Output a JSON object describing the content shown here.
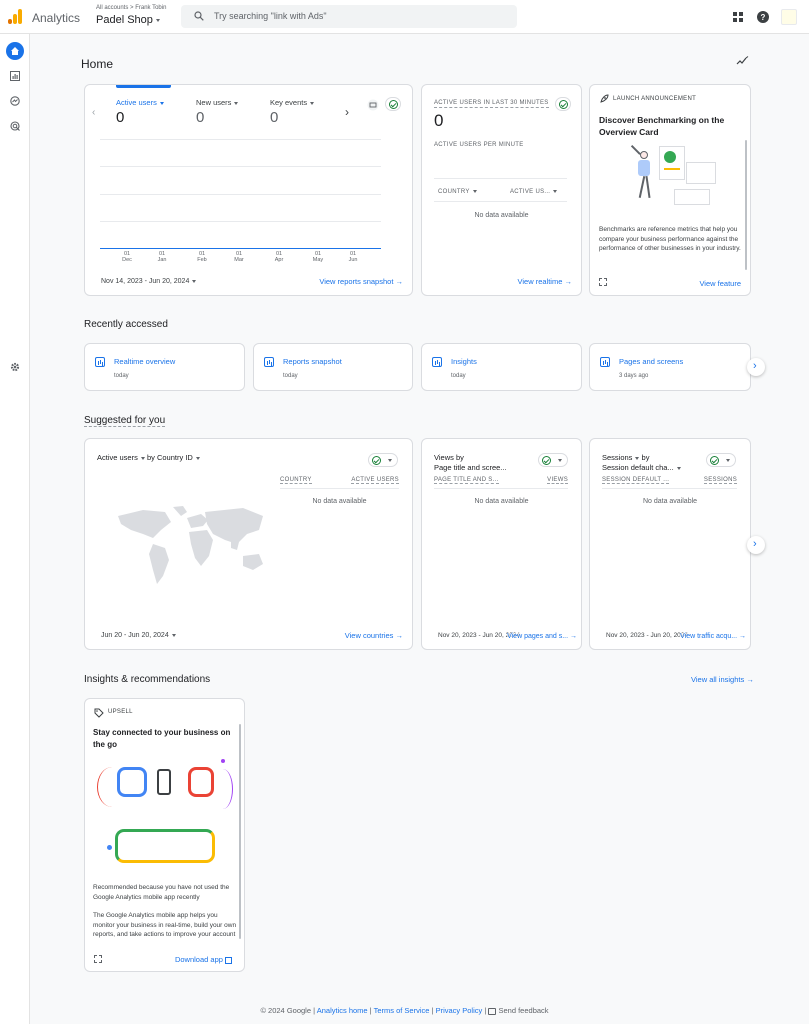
{
  "header": {
    "brand": "Analytics",
    "breadcrumb": "All accounts > Frank Tobin",
    "property": "Padel Shop",
    "search_placeholder": "Try searching \"link with Ads\""
  },
  "page": {
    "title": "Home"
  },
  "overview": {
    "metrics": [
      {
        "label": "Active users",
        "value": "0"
      },
      {
        "label": "New users",
        "value": "0"
      },
      {
        "label": "Key events",
        "value": "0"
      }
    ],
    "x_ticks": [
      {
        "day": "01",
        "month": "Dec"
      },
      {
        "day": "01",
        "month": "Jan"
      },
      {
        "day": "01",
        "month": "Feb"
      },
      {
        "day": "01",
        "month": "Mar"
      },
      {
        "day": "01",
        "month": "Apr"
      },
      {
        "day": "01",
        "month": "May"
      },
      {
        "day": "01",
        "month": "Jun"
      }
    ],
    "date_range": "Nov 14, 2023 - Jun 20, 2024",
    "link": "View reports snapshot"
  },
  "realtime": {
    "title": "ACTIVE USERS IN LAST 30 MINUTES",
    "value": "0",
    "per_minute": "ACTIVE USERS PER MINUTE",
    "col_country": "COUNTRY",
    "col_users": "ACTIVE US...",
    "empty": "No data available",
    "link": "View realtime"
  },
  "launch": {
    "tag": "LAUNCH ANNOUNCEMENT",
    "title": "Discover Benchmarking on the Overview Card",
    "body": "Benchmarks are reference metrics that help you compare your business performance against the performance of other businesses in your industry.",
    "link": "View feature"
  },
  "recent": {
    "title": "Recently accessed",
    "items": [
      {
        "label": "Realtime overview",
        "time": "today"
      },
      {
        "label": "Reports snapshot",
        "time": "today"
      },
      {
        "label": "Insights",
        "time": "today"
      },
      {
        "label": "Pages and screens",
        "time": "3 days ago"
      }
    ]
  },
  "suggested": {
    "title": "Suggested for you",
    "card1": {
      "metric": "Active users",
      "by": "by",
      "dim": "Country ID",
      "col1": "COUNTRY",
      "col2": "ACTIVE USERS",
      "empty": "No data available",
      "date": "Jun 20 - Jun 20, 2024",
      "link": "View countries"
    },
    "card2": {
      "metric": "Views by",
      "dim": "Page title and scree...",
      "col1": "PAGE TITLE AND S...",
      "col2": "VIEWS",
      "empty": "No data available",
      "date": "Nov 20, 2023 - Jun 20, 2024",
      "link": "View pages and s..."
    },
    "card3": {
      "metric": "Sessions",
      "by": "by",
      "dim": "Session default cha...",
      "col1": "SESSION DEFAULT ...",
      "col2": "SESSIONS",
      "empty": "No data available",
      "date": "Nov 20, 2023 - Jun 20, 2024",
      "link": "View traffic acqu..."
    }
  },
  "insights": {
    "title": "Insights & recommendations",
    "view_all": "View all insights",
    "card": {
      "tag": "UPSELL",
      "title": "Stay connected to your business on the go",
      "reason": "Recommended because you have not used the Google Analytics mobile app recently",
      "body": "The Google Analytics mobile app helps you monitor your business in real-time, build your own reports, and take actions to improve your account",
      "link": "Download app"
    }
  },
  "footer": {
    "copyright": "© 2024 Google |",
    "home": "Analytics home",
    "tos": "Terms of Service",
    "privacy": "Privacy Policy",
    "feedback": "Send feedback",
    "sep": "|"
  },
  "colors": {
    "accent": "#1a73e8",
    "ok": "#188038",
    "brand_orange": "#f9ab00",
    "brand_dark": "#e37400"
  }
}
